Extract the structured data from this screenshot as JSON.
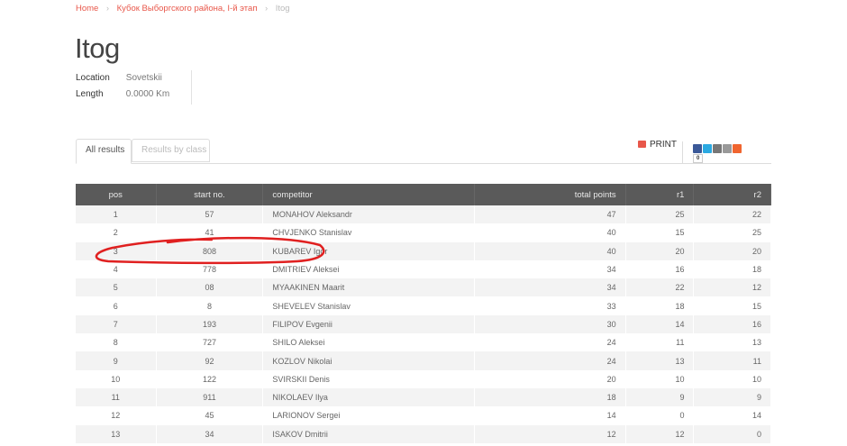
{
  "breadcrumb": {
    "home": "Home",
    "event": "Кубок Выборгского района, I-й этап",
    "current": "Itog",
    "sep": "›"
  },
  "page_title": "Itog",
  "meta": {
    "location_label": "Location",
    "location_value": "Sovetskii",
    "length_label": "Length",
    "length_value": "0.0000 Km"
  },
  "tabs": {
    "all": "All results",
    "by_class": "Results by class"
  },
  "toolbar": {
    "print_label": "PRINT",
    "share_count": "0"
  },
  "share_icons": [
    {
      "name": "facebook-icon",
      "color": "#3b5998"
    },
    {
      "name": "twitter-icon",
      "color": "#2ba9e1"
    },
    {
      "name": "email-icon",
      "color": "#777777"
    },
    {
      "name": "printer-icon",
      "color": "#999999"
    },
    {
      "name": "add-icon",
      "color": "#f0652f"
    }
  ],
  "annotation": {
    "color": "#e02020",
    "highlighted_row": 3
  },
  "table": {
    "headers": {
      "pos": "pos",
      "start": "start no.",
      "competitor": "competitor",
      "total": "total points",
      "r1": "r1",
      "r2": "r2"
    },
    "rows": [
      {
        "pos": "1",
        "start": "57",
        "competitor": "MONAHOV Aleksandr",
        "total": "47",
        "r1": "25",
        "r2": "22"
      },
      {
        "pos": "2",
        "start": "41",
        "competitor": "CHVJENKO Stanislav",
        "total": "40",
        "r1": "15",
        "r2": "25"
      },
      {
        "pos": "3",
        "start": "808",
        "competitor": "KUBAREV Igor",
        "total": "40",
        "r1": "20",
        "r2": "20"
      },
      {
        "pos": "4",
        "start": "778",
        "competitor": "DMITRIEV Aleksei",
        "total": "34",
        "r1": "16",
        "r2": "18"
      },
      {
        "pos": "5",
        "start": "08",
        "competitor": "MYAAKINEN Maarit",
        "total": "34",
        "r1": "22",
        "r2": "12"
      },
      {
        "pos": "6",
        "start": "8",
        "competitor": "SHEVELEV Stanislav",
        "total": "33",
        "r1": "18",
        "r2": "15"
      },
      {
        "pos": "7",
        "start": "193",
        "competitor": "FILIPOV Evgenii",
        "total": "30",
        "r1": "14",
        "r2": "16"
      },
      {
        "pos": "8",
        "start": "727",
        "competitor": "SHILO Aleksei",
        "total": "24",
        "r1": "11",
        "r2": "13"
      },
      {
        "pos": "9",
        "start": "92",
        "competitor": "KOZLOV Nikolai",
        "total": "24",
        "r1": "13",
        "r2": "11"
      },
      {
        "pos": "10",
        "start": "122",
        "competitor": "SVIRSKII Denis",
        "total": "20",
        "r1": "10",
        "r2": "10"
      },
      {
        "pos": "11",
        "start": "911",
        "competitor": "NIKOLAEV Ilya",
        "total": "18",
        "r1": "9",
        "r2": "9"
      },
      {
        "pos": "12",
        "start": "45",
        "competitor": "LARIONOV Sergei",
        "total": "14",
        "r1": "0",
        "r2": "14"
      },
      {
        "pos": "13",
        "start": "34",
        "competitor": "ISAKOV Dmitrii",
        "total": "12",
        "r1": "12",
        "r2": "0"
      }
    ]
  }
}
